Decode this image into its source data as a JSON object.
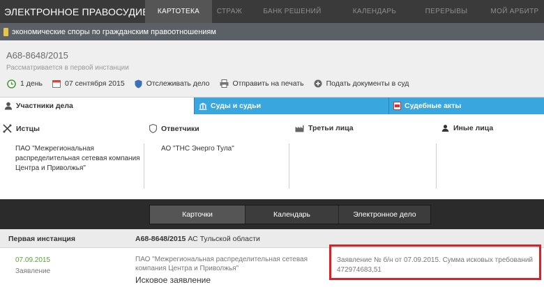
{
  "brand": "ЭЛЕКТРОННОЕ ПРАВОСУДИЕ",
  "nav": [
    {
      "label": "КАРТОТЕКА"
    },
    {
      "label": "СТРАЖ"
    },
    {
      "label": "БАНК РЕШЕНИЙ"
    },
    {
      "label": "КАЛЕНДАРЬ"
    },
    {
      "label": "ПЕРЕРЫВЫ"
    },
    {
      "label": "МОЙ АРБИТР"
    }
  ],
  "dispute_category": "экономические споры по гражданским правоотношениям",
  "case": {
    "number": "А68-8648/2015",
    "status": "Рассматривается в первой инстанции"
  },
  "actions": {
    "duration": "1 день",
    "date": "07 сентября 2015",
    "track": "Отслеживать дело",
    "print": "Отправить на печать",
    "submit": "Подать документы в суд"
  },
  "section_tabs": [
    {
      "label": "Участники дела"
    },
    {
      "label": "Суды и судьи"
    },
    {
      "label": "Судебные акты"
    }
  ],
  "participants": {
    "plaintiffs": {
      "title": "Истцы",
      "value": "ПАО \"Межрегиональная распределительная сетевая компания Центра и Приволжья\""
    },
    "defendants": {
      "title": "Ответчики",
      "value": "АО \"ТНС Энерго Тула\""
    },
    "third": {
      "title": "Третьи лица",
      "value": ""
    },
    "others": {
      "title": "Иные лица",
      "value": ""
    }
  },
  "band_tabs": [
    {
      "label": "Карточки"
    },
    {
      "label": "Календарь"
    },
    {
      "label": "Электронное дело"
    }
  ],
  "instance": {
    "label": "Первая инстанция",
    "case_number": "А68-8648/2015",
    "court": " АС Тульской области"
  },
  "document": {
    "date": "07.09.2015",
    "type": "Заявление",
    "party": "ПАО \"Межрегиональная распределительная сетевая компания Центра и Приволжья\"",
    "title": "Исковое заявление",
    "note": "Заявление № б/н от 07.09.2015. Сумма исковых требований 472974683,51"
  },
  "colors": {
    "accent_tab": "#3aa6de",
    "date_green": "#5aa43a",
    "highlight_red": "#e01f24"
  }
}
